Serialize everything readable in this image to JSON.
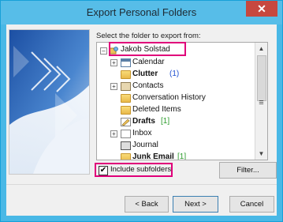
{
  "window": {
    "title": "Export Personal Folders",
    "close_glyph": "✕"
  },
  "prompt": "Select the folder to export from:",
  "tree": {
    "root": {
      "label": "Jakob Solstad",
      "expander": "–",
      "icon": "mailbox-icon"
    },
    "items": [
      {
        "label": "Calendar",
        "expander": "+",
        "icon": "calendar-icon",
        "bold": false,
        "count": ""
      },
      {
        "label": "Clutter",
        "expander": "",
        "icon": "folder-icon",
        "bold": true,
        "count": "(1)"
      },
      {
        "label": "Contacts",
        "expander": "+",
        "icon": "contacts-icon",
        "bold": false,
        "count": ""
      },
      {
        "label": "Conversation History",
        "expander": "",
        "icon": "folder-icon",
        "bold": false,
        "count": ""
      },
      {
        "label": "Deleted Items",
        "expander": "",
        "icon": "folder-icon",
        "bold": false,
        "count": ""
      },
      {
        "label": "Drafts",
        "expander": "",
        "icon": "drafts-icon",
        "bold": true,
        "count": "[1]"
      },
      {
        "label": "Inbox",
        "expander": "+",
        "icon": "inbox-icon",
        "bold": false,
        "count": ""
      },
      {
        "label": "Journal",
        "expander": "",
        "icon": "journal-icon",
        "bold": false,
        "count": ""
      },
      {
        "label": "Junk Email",
        "expander": "",
        "icon": "junk-icon",
        "bold": true,
        "count": "[1]"
      }
    ],
    "scrollbar": {
      "up": "▲",
      "down": "▼",
      "grip": "≡"
    }
  },
  "include_subfolders": {
    "label": "Include subfolders",
    "checked": true,
    "check_glyph": "✔"
  },
  "buttons": {
    "filter": "Filter...",
    "back": "< Back",
    "next": "Next >",
    "cancel": "Cancel"
  },
  "colors": {
    "highlight": "#e0007a",
    "title_bar": "#57bde8",
    "count_blue": "#1f4fd1",
    "count_green": "#2b9b2b"
  }
}
